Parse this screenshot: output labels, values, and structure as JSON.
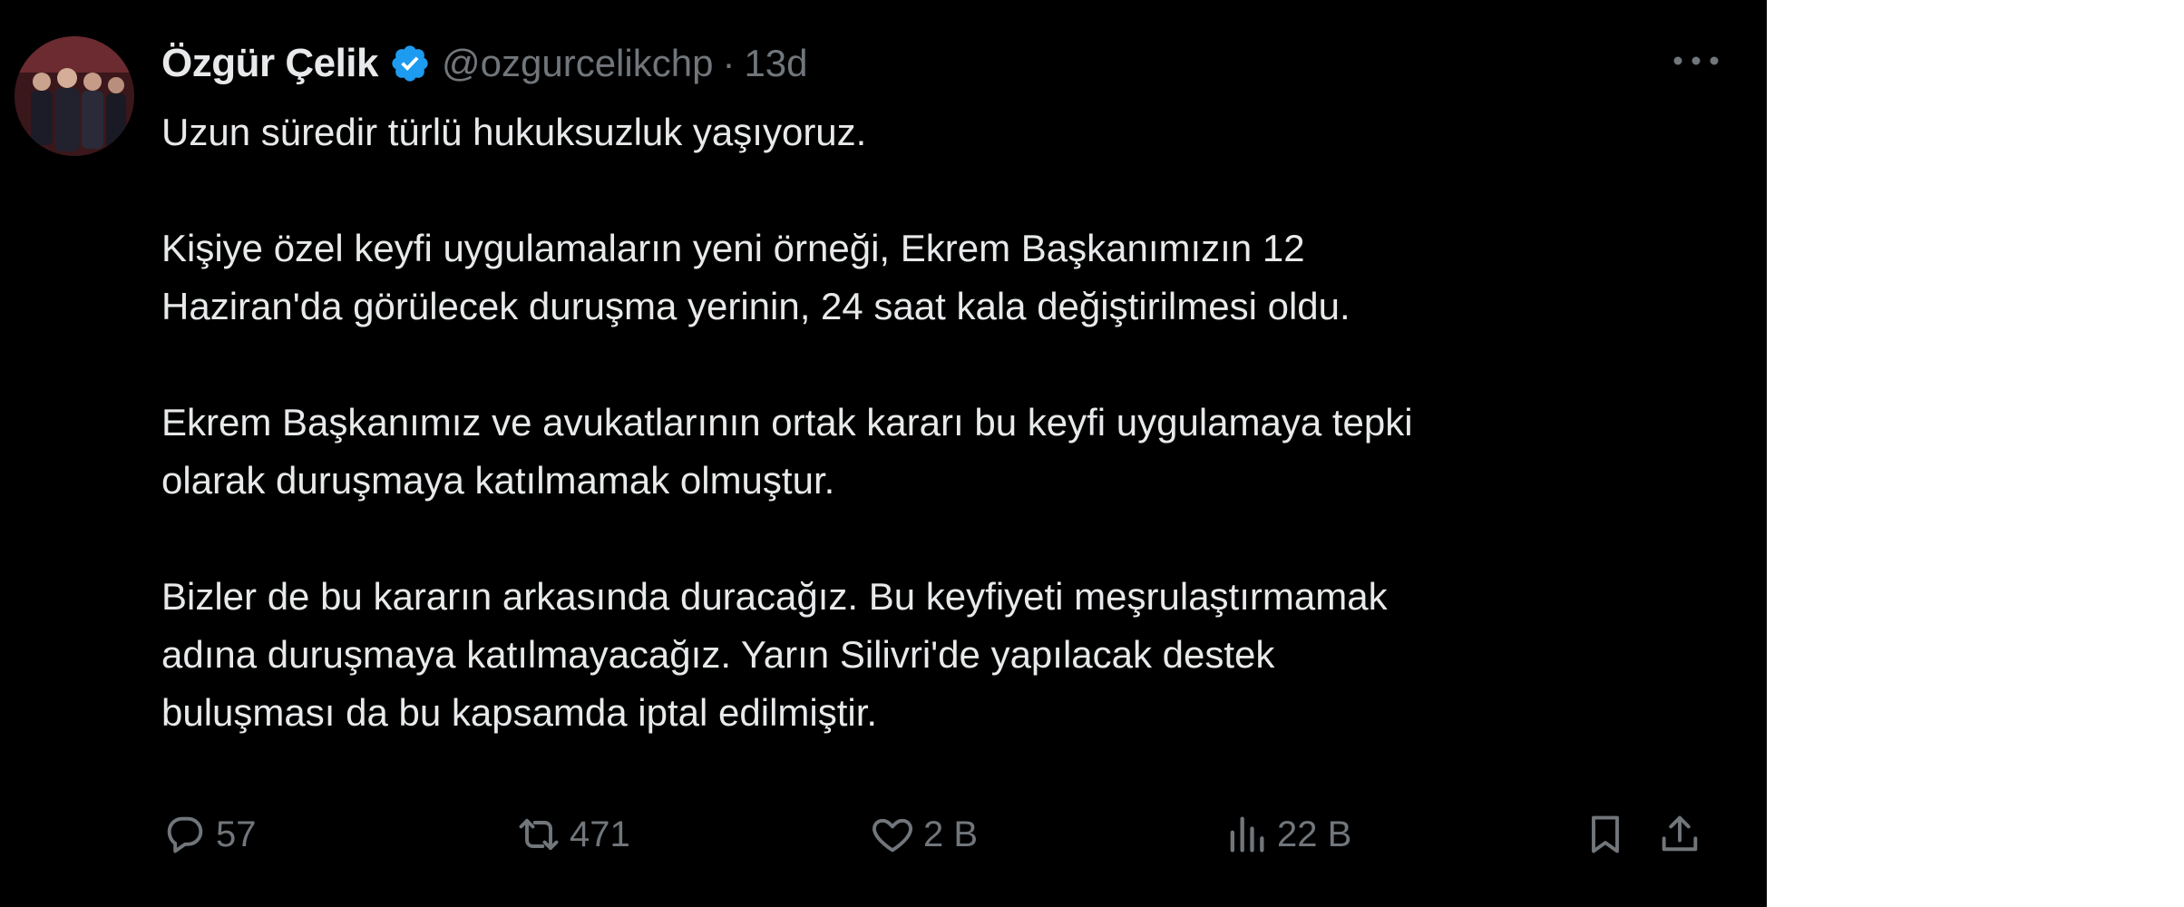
{
  "tweet": {
    "display_name": "Özgür Çelik",
    "handle": "@ozgurcelikchp",
    "separator": "·",
    "time": "13d",
    "paragraphs": [
      [
        "Uzun süredir türlü hukuksuzluk yaşıyoruz."
      ],
      [
        "Kişiye özel keyfi uygulamaların yeni örneği, Ekrem Başkanımızın 12",
        "Haziran'da görülecek duruşma yerinin, 24 saat kala değiştirilmesi oldu."
      ],
      [
        "Ekrem Başkanımız ve avukatlarının ortak kararı bu keyfi uygulamaya tepki",
        "olarak duruşmaya katılmamak olmuştur."
      ],
      [
        "Bizler de bu kararın arkasında duracağız. Bu keyfiyeti meşrulaştırmamak",
        "adına duruşmaya katılmayacağız. Yarın Silivri'de yapılacak destek",
        "buluşması da bu kapsamda iptal edilmiştir."
      ]
    ]
  },
  "actions": {
    "reply": {
      "icon": "reply-icon",
      "count": "57"
    },
    "retweet": {
      "icon": "retweet-icon",
      "count": "471"
    },
    "like": {
      "icon": "heart-icon",
      "count": "2 B"
    },
    "views": {
      "icon": "views-icon",
      "count": "22 B"
    },
    "bookmark": {
      "icon": "bookmark-icon"
    },
    "share": {
      "icon": "share-icon"
    }
  },
  "colors": {
    "background": "#000000",
    "text_primary": "#e7e9ea",
    "text_secondary": "#71767b",
    "verified": "#1d9bf0"
  }
}
